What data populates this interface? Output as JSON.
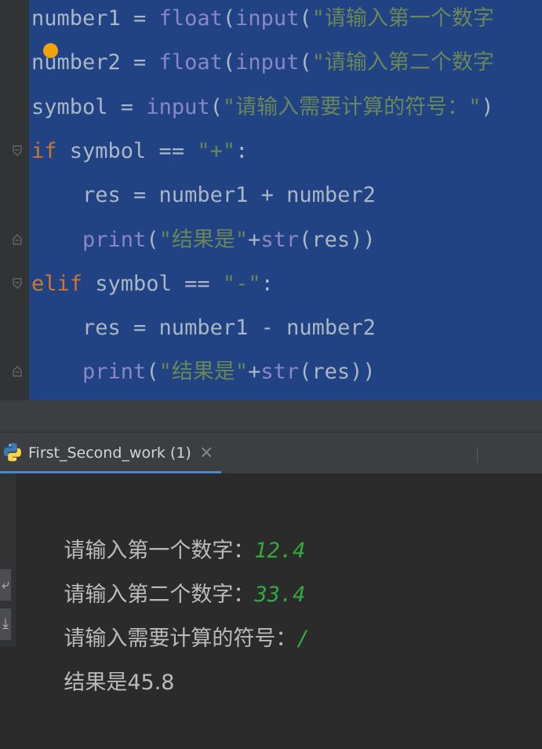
{
  "editor": {
    "lines": [
      {
        "parts": [
          [
            "t",
            "number1 = "
          ],
          [
            "fn",
            "float"
          ],
          [
            "t",
            "("
          ],
          [
            "fn",
            "input"
          ],
          [
            "t",
            "("
          ],
          [
            "str",
            "\"请输入第一个数字"
          ]
        ]
      },
      {
        "parts": [
          [
            "t",
            "number2 = "
          ],
          [
            "fn",
            "float"
          ],
          [
            "t",
            "("
          ],
          [
            "fn",
            "input"
          ],
          [
            "t",
            "("
          ],
          [
            "str",
            "\"请输入第二个数字"
          ]
        ]
      },
      {
        "parts": [
          [
            "t",
            "symbol = "
          ],
          [
            "fn",
            "input"
          ],
          [
            "t",
            "("
          ],
          [
            "str",
            "\"请输入需要计算的符号：\""
          ],
          [
            "t",
            ")"
          ]
        ]
      },
      {
        "parts": [
          [
            "kw",
            "if"
          ],
          [
            "t",
            " symbol == "
          ],
          [
            "str",
            "\"+\""
          ],
          [
            "t",
            ":"
          ]
        ]
      },
      {
        "parts": [
          [
            "t",
            "    res = number1 + number2"
          ]
        ]
      },
      {
        "parts": [
          [
            "t",
            "    "
          ],
          [
            "fn",
            "print"
          ],
          [
            "t",
            "("
          ],
          [
            "str",
            "\"结果是\""
          ],
          [
            "t",
            "+"
          ],
          [
            "fn",
            "str"
          ],
          [
            "t",
            "(res))"
          ]
        ]
      },
      {
        "parts": [
          [
            "kw",
            "elif"
          ],
          [
            "t",
            " symbol == "
          ],
          [
            "str",
            "\"-\""
          ],
          [
            "t",
            ":"
          ]
        ]
      },
      {
        "parts": [
          [
            "t",
            "    res = number1 - number2"
          ]
        ]
      },
      {
        "parts": [
          [
            "t",
            "    "
          ],
          [
            "fn",
            "print"
          ],
          [
            "t",
            "("
          ],
          [
            "str",
            "\"结果是\""
          ],
          [
            "t",
            "+"
          ],
          [
            "fn",
            "str"
          ],
          [
            "t",
            "(res))"
          ]
        ]
      }
    ]
  },
  "run_tab": {
    "label": "First_Second_work (1)",
    "close": "×"
  },
  "console": {
    "lines": [
      {
        "prompt": "请输入第一个数字：",
        "value": "12.4"
      },
      {
        "prompt": "请输入第二个数字：",
        "value": "33.4"
      },
      {
        "prompt": "请输入需要计算的符号：",
        "value": "/"
      },
      {
        "prompt": "结果是45.8",
        "value": ""
      }
    ]
  },
  "colors": {
    "selection": "#214283",
    "keyword": "#cc7832",
    "builtin": "#8888c6",
    "string": "#6a8759",
    "input_value": "#35a840"
  }
}
